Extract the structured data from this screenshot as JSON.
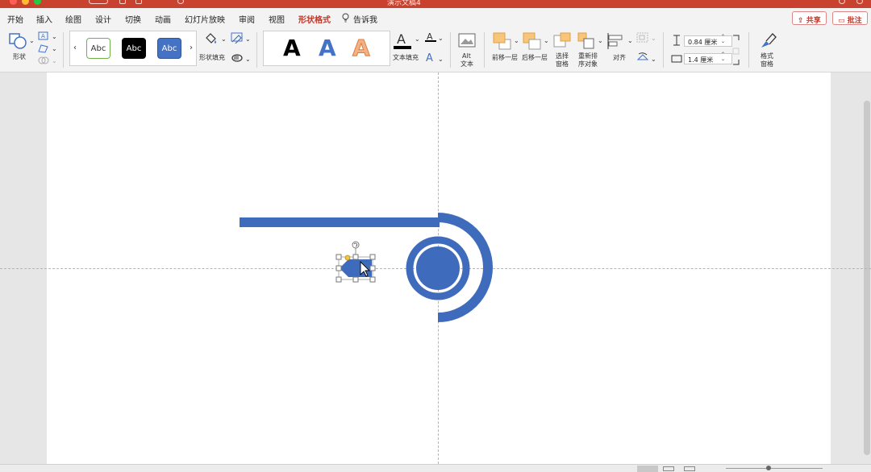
{
  "window": {
    "title": "演示文稿4"
  },
  "menubar": {
    "tabs": [
      "开始",
      "插入",
      "绘图",
      "设计",
      "切换",
      "动画",
      "幻灯片放映",
      "审阅",
      "视图",
      "形状格式",
      "告诉我"
    ],
    "active_tab": "形状格式",
    "share_label": "共享",
    "comment_label": "批注"
  },
  "ribbon": {
    "shape_label": "形状",
    "style_samples": [
      "Abc",
      "Abc",
      "Abc"
    ],
    "shape_fill_label": "形状填充",
    "wordart_samples": [
      "A",
      "A",
      "A"
    ],
    "text_fill_label": "文本填充",
    "alt_text_label": [
      "Alt",
      "文本"
    ],
    "bring_forward_label": "前移一层",
    "send_backward_label": "后移一层",
    "selection_pane_label": [
      "选择",
      "窗格"
    ],
    "reorder_label": [
      "重新排",
      "序对象"
    ],
    "align_label": "对齐",
    "height_value": "0.84 厘米",
    "width_value": "1.4 厘米",
    "format_pane_label": [
      "格式",
      "窗格"
    ]
  },
  "colors": {
    "accent": "#c0392b",
    "shape_blue": "#3f6bbd",
    "titlebar": "#c9422f"
  }
}
